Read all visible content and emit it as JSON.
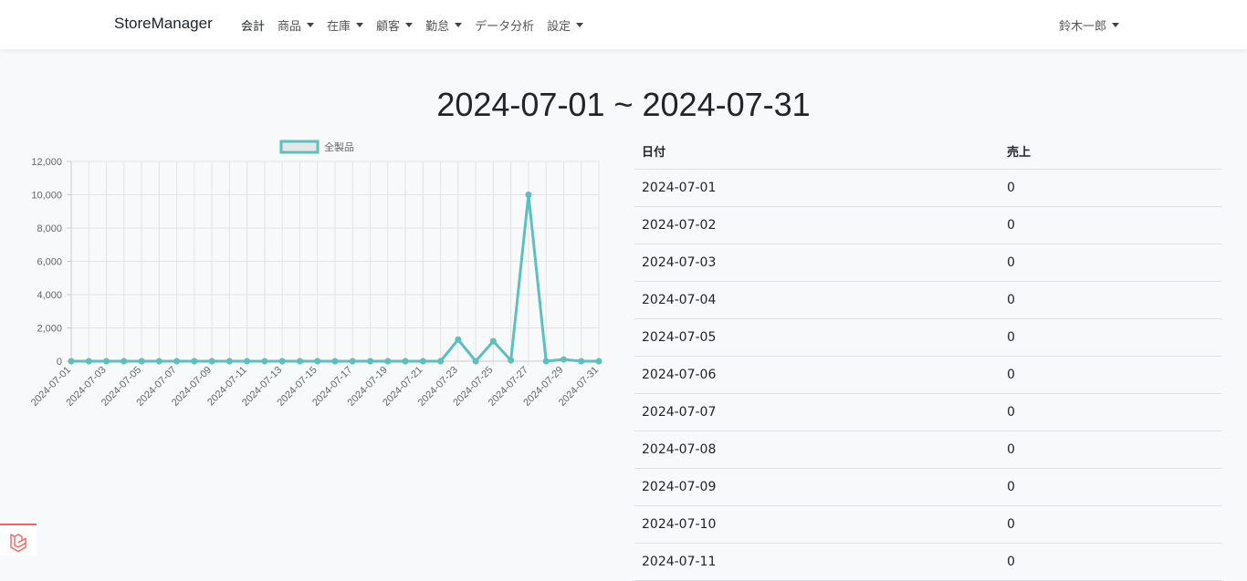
{
  "navbar": {
    "brand": "StoreManager",
    "items": [
      {
        "label": "会計",
        "dropdown": false
      },
      {
        "label": "商品",
        "dropdown": true
      },
      {
        "label": "在庫",
        "dropdown": true
      },
      {
        "label": "顧客",
        "dropdown": true
      },
      {
        "label": "勤怠",
        "dropdown": true
      },
      {
        "label": "データ分析",
        "dropdown": false
      },
      {
        "label": "設定",
        "dropdown": true
      }
    ],
    "user": "鈴木一郎"
  },
  "page": {
    "title": "2024-07-01 ~ 2024-07-31"
  },
  "chart_data": {
    "type": "line",
    "series": [
      {
        "name": "全製品",
        "color": "#5bc0be",
        "values": [
          0,
          0,
          0,
          0,
          0,
          0,
          0,
          0,
          0,
          0,
          0,
          0,
          0,
          0,
          0,
          0,
          0,
          0,
          0,
          0,
          0,
          0,
          1300,
          0,
          1200,
          50,
          10000,
          0,
          100,
          0,
          0
        ]
      }
    ],
    "x": [
      "2024-07-01",
      "2024-07-02",
      "2024-07-03",
      "2024-07-04",
      "2024-07-05",
      "2024-07-06",
      "2024-07-07",
      "2024-07-08",
      "2024-07-09",
      "2024-07-10",
      "2024-07-11",
      "2024-07-12",
      "2024-07-13",
      "2024-07-14",
      "2024-07-15",
      "2024-07-16",
      "2024-07-17",
      "2024-07-18",
      "2024-07-19",
      "2024-07-20",
      "2024-07-21",
      "2024-07-22",
      "2024-07-23",
      "2024-07-24",
      "2024-07-25",
      "2024-07-26",
      "2024-07-27",
      "2024-07-28",
      "2024-07-29",
      "2024-07-30",
      "2024-07-31"
    ],
    "x_tick_labels": [
      "2024-07-01",
      "2024-07-03",
      "2024-07-05",
      "2024-07-07",
      "2024-07-09",
      "2024-07-11",
      "2024-07-13",
      "2024-07-15",
      "2024-07-17",
      "2024-07-19",
      "2024-07-21",
      "2024-07-23",
      "2024-07-25",
      "2024-07-27",
      "2024-07-29",
      "2024-07-31"
    ],
    "y_tick_labels": [
      "0",
      "2,000",
      "4,000",
      "6,000",
      "8,000",
      "10,000",
      "12,000"
    ],
    "ylim": [
      0,
      12000
    ],
    "grid": true,
    "legend": "top"
  },
  "table": {
    "headers": [
      "日付",
      "売上"
    ],
    "rows": [
      [
        "2024-07-01",
        "0"
      ],
      [
        "2024-07-02",
        "0"
      ],
      [
        "2024-07-03",
        "0"
      ],
      [
        "2024-07-04",
        "0"
      ],
      [
        "2024-07-05",
        "0"
      ],
      [
        "2024-07-06",
        "0"
      ],
      [
        "2024-07-07",
        "0"
      ],
      [
        "2024-07-08",
        "0"
      ],
      [
        "2024-07-09",
        "0"
      ],
      [
        "2024-07-10",
        "0"
      ],
      [
        "2024-07-11",
        "0"
      ]
    ]
  },
  "icons": {
    "corner_logo": "laravel-logo-icon"
  }
}
